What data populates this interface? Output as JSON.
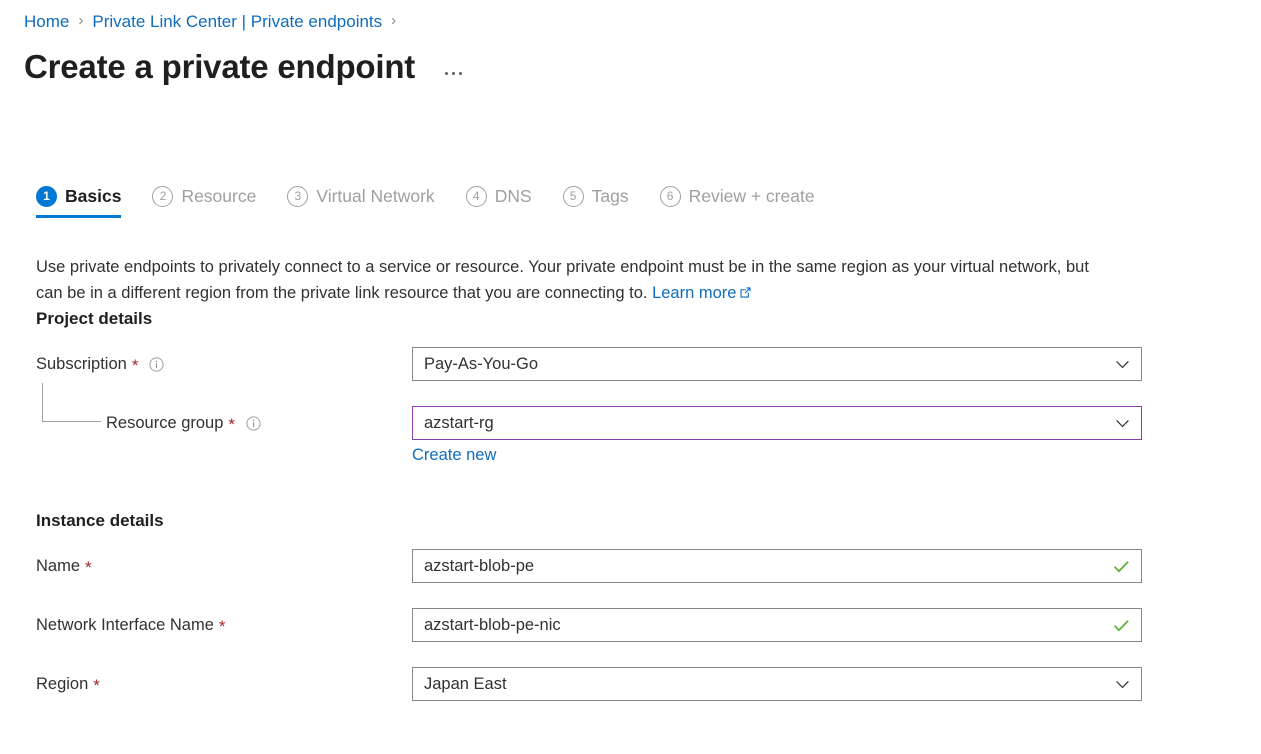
{
  "breadcrumb": {
    "items": [
      "Home",
      "Private Link Center | Private endpoints"
    ],
    "separator": "›"
  },
  "header": {
    "title": "Create a private endpoint",
    "more_menu": "…"
  },
  "tabs": [
    {
      "num": "1",
      "label": "Basics",
      "active": true
    },
    {
      "num": "2",
      "label": "Resource",
      "active": false
    },
    {
      "num": "3",
      "label": "Virtual Network",
      "active": false
    },
    {
      "num": "4",
      "label": "DNS",
      "active": false
    },
    {
      "num": "5",
      "label": "Tags",
      "active": false
    },
    {
      "num": "6",
      "label": "Review + create",
      "active": false
    }
  ],
  "description": {
    "text": "Use private endpoints to privately connect to a service or resource. Your private endpoint must be in the same region as your virtual network, but can be in a different region from the private link resource that you are connecting to. ",
    "link_label": "Learn more"
  },
  "sections": {
    "project_details": "Project details",
    "instance_details": "Instance details"
  },
  "fields": {
    "subscription": {
      "label": "Subscription",
      "required": "*",
      "value": "Pay-As-You-Go",
      "type": "dropdown",
      "focused": false
    },
    "resource_group": {
      "label": "Resource group",
      "required": "*",
      "value": "azstart-rg",
      "type": "dropdown",
      "focused": true,
      "create_new_label": "Create new"
    },
    "name": {
      "label": "Name",
      "required": "*",
      "value": "azstart-blob-pe",
      "type": "textbox",
      "valid": true
    },
    "network_interface_name": {
      "label": "Network Interface Name",
      "required": "*",
      "value": "azstart-blob-pe-nic",
      "type": "textbox",
      "valid": true
    },
    "region": {
      "label": "Region",
      "required": "*",
      "value": "Japan East",
      "type": "dropdown",
      "focused": false
    }
  },
  "colors": {
    "accent_blue": "#0078d4",
    "link_blue": "#0f6cbd",
    "focus_purple": "#8c3fa8",
    "required_red": "#a4262c",
    "valid_green": "#5cb338",
    "border_gray": "#8a8886",
    "muted_gray": "#a19f9d"
  }
}
